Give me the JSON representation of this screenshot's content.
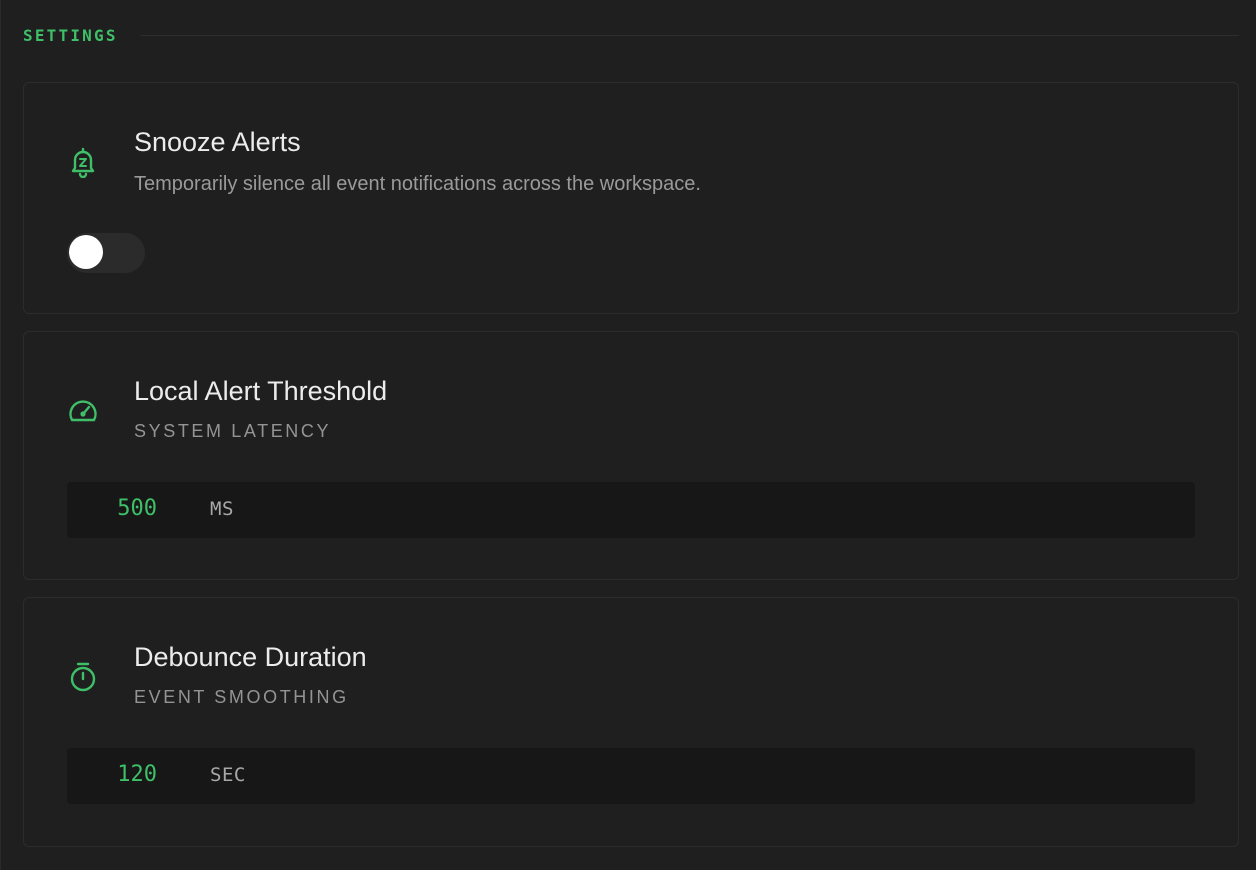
{
  "section": {
    "title": "SETTINGS"
  },
  "snooze": {
    "icon": "bell-snooze-icon",
    "title": "Snooze Alerts",
    "description": "Temporarily silence all event notifications across the workspace.",
    "enabled": false
  },
  "threshold": {
    "icon": "gauge-icon",
    "title": "Local Alert Threshold",
    "subtitle": "SYSTEM LATENCY",
    "value": "500",
    "unit": "MS"
  },
  "debounce": {
    "icon": "stopwatch-icon",
    "title": "Debounce Duration",
    "subtitle": "EVENT SMOOTHING",
    "value": "120",
    "unit": "SEC"
  },
  "colors": {
    "accent": "#3fbf68",
    "background": "#1f1f1f",
    "field": "#171717"
  }
}
